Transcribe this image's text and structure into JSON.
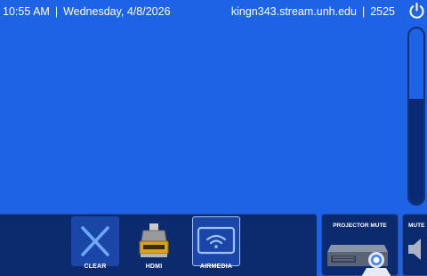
{
  "status_bar": {
    "time": "10:55 AM",
    "separator": "|",
    "date": "Wednesday, 4/8/2026",
    "host": "kingn343.stream.unh.edu",
    "room_code": "2525"
  },
  "power": {
    "icon": "power-icon"
  },
  "volume": {
    "level_fraction": 0.6
  },
  "sources": [
    {
      "label": "CLEAR",
      "icon": "close-icon"
    },
    {
      "label": "HDMI",
      "icon": "hdmi-icon"
    },
    {
      "label": "AIRMEDIA",
      "icon": "wifi-screen-icon",
      "selected": true
    }
  ],
  "projector_mute": {
    "label": "PROJECTOR MUTE",
    "icon": "projector-icon"
  },
  "mute": {
    "label": "MUTE",
    "icon": "speaker-icon"
  },
  "colors": {
    "background": "#1e63e6",
    "panel": "#0c2a6e",
    "button": "#1a46a8",
    "text": "#ffffff"
  }
}
